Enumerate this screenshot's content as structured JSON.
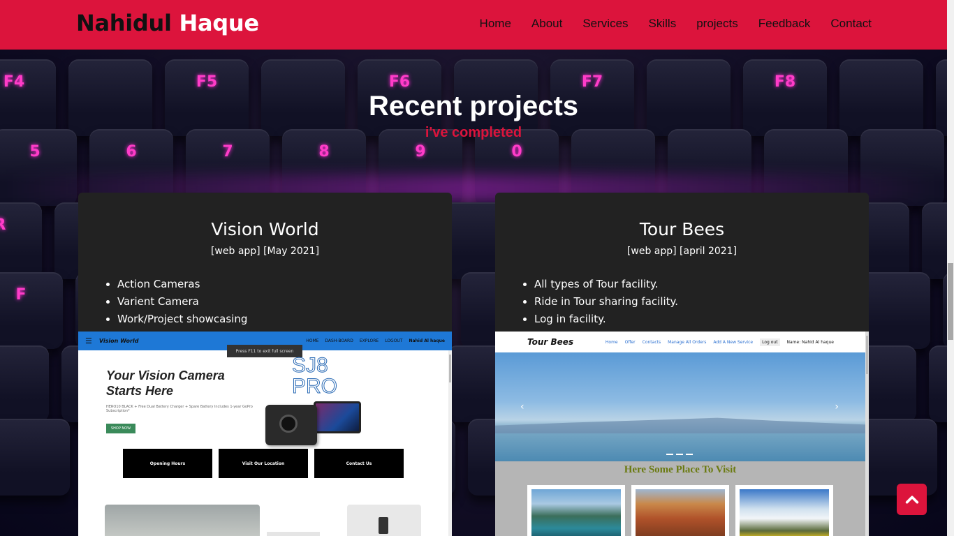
{
  "brand": {
    "first": "Nahidul",
    "last": "Haque"
  },
  "nav": {
    "items": [
      "Home",
      "About",
      "Services",
      "Skills",
      "projects",
      "Feedback",
      "Contact"
    ]
  },
  "section": {
    "title": "Recent projects",
    "subtitle": "i've completed"
  },
  "projects": [
    {
      "title": "Vision World",
      "meta": "[web app] [May 2021]",
      "features": [
        "Action Cameras",
        "Varient Camera",
        "Work/Project showcasing"
      ],
      "preview": {
        "brand": "Vision World",
        "links": [
          "HOME",
          "DASH-BOARD",
          "EXPLORE",
          "LOGOUT",
          "Nahid Al haque"
        ],
        "toast": "Press F11 to exit full screen",
        "hero_line1": "Your Vision Camera",
        "hero_line2": "Starts Here",
        "hero_sub": "HERO10 BLACK + Free Dual Battery Charger + Spare Battery Includes 1-year GoPro Subscription*",
        "shop": "SHOP NOW",
        "logo_line1": "SJ8",
        "logo_line2": "PRO",
        "buttons": [
          "Opening Hours",
          "Visit Our Location",
          "Contact Us"
        ]
      }
    },
    {
      "title": "Tour Bees",
      "meta": "[web app] [april 2021]",
      "features": [
        "All types of Tour facility.",
        "Ride in Tour sharing facility.",
        "Log in facility."
      ],
      "preview": {
        "brand": "Tour Bees",
        "links": [
          "Home",
          "Offer",
          "Contacts",
          "Manage All Orders",
          "Add A New Service"
        ],
        "logout": "Log out",
        "name": "Name: Nahid Al haque",
        "section_title": "Here Some Place To Visit"
      }
    }
  ],
  "colors": {
    "accent": "#dc143c",
    "card_bg": "#222222"
  },
  "icons": {
    "back_to_top": "chevron-up-icon"
  }
}
